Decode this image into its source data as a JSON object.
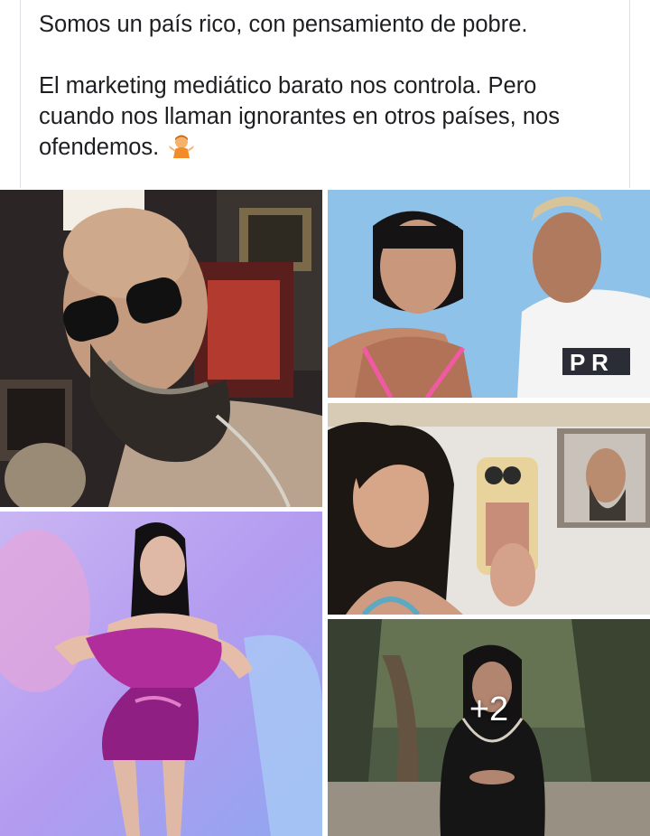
{
  "post": {
    "line1": "Somos un país rico, con pensamiento de pobre.",
    "line2": "El marketing mediático barato nos controla. Pero cuando nos llaman ignorantes en otros países, nos ofendemos.",
    "emoji_icon": "person-shrugging-icon"
  },
  "gallery": {
    "photos": [
      {
        "name": "bearded-man-selfie",
        "jersey_text": ""
      },
      {
        "name": "couple-photo",
        "jersey_text": "P R"
      },
      {
        "name": "woman-mirror-selfie"
      },
      {
        "name": "woman-pink-dress"
      },
      {
        "name": "woman-black-dress"
      }
    ],
    "more_count_label": "+2"
  },
  "colors": {
    "text": "#1c1e21",
    "border": "#dcdfe3",
    "overlay_text": "#ffffff"
  }
}
